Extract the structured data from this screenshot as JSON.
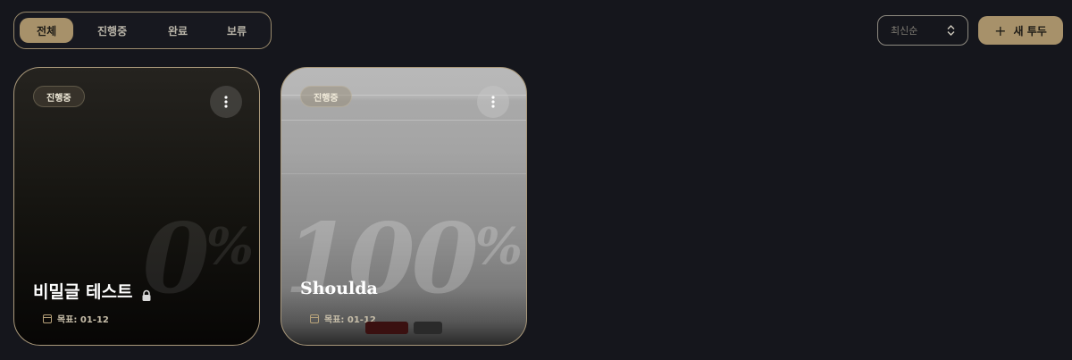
{
  "filters": {
    "tabs": [
      {
        "label": "전체",
        "active": true
      },
      {
        "label": "진행중",
        "active": false
      },
      {
        "label": "완료",
        "active": false
      },
      {
        "label": "보류",
        "active": false
      }
    ]
  },
  "toolbar": {
    "sort_value": "최신순",
    "new_button_label": "새 투두",
    "accent_color": "#a7916a"
  },
  "cards": [
    {
      "status": "진행중",
      "percent_number": "0",
      "percent_sign": "%",
      "title": "비밀글 테스트",
      "locked": true,
      "due": "목표: 01-12"
    },
    {
      "status": "진행중",
      "percent_number": "100",
      "percent_sign": "%",
      "title": "Shoulda",
      "locked": false,
      "due": "목표: 01-12"
    }
  ]
}
